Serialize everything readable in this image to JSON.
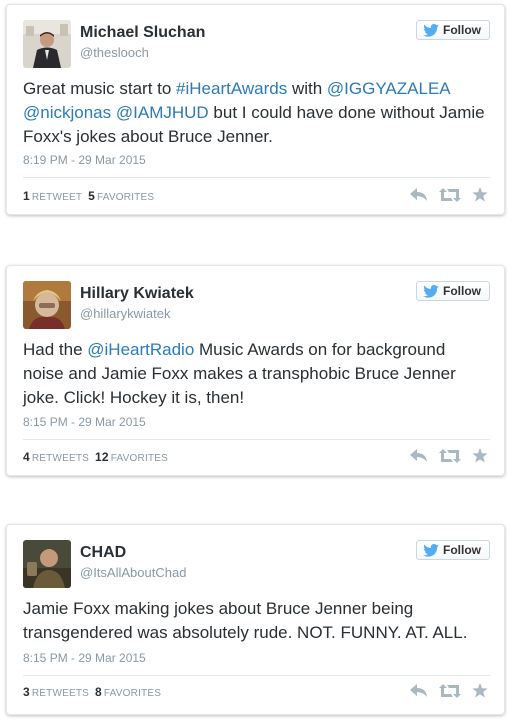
{
  "colors": {
    "link": "#2b7bb9",
    "muted": "#8899a6",
    "icon": "#aab8c2",
    "twitter_blue": "#55acee"
  },
  "tweets": [
    {
      "name": "Michael Sluchan",
      "handle": "@theslooch",
      "follow_label": "Follow",
      "text_parts": [
        {
          "t": "Great music start to ",
          "link": false
        },
        {
          "t": "#iHeartAwards",
          "link": true
        },
        {
          "t": " with ",
          "link": false
        },
        {
          "t": "@IGGYAZALEA",
          "link": true
        },
        {
          "t": " ",
          "link": false
        },
        {
          "t": "@nickjonas",
          "link": true
        },
        {
          "t": " ",
          "link": false
        },
        {
          "t": "@IAMJHUD",
          "link": true
        },
        {
          "t": " but I could have done without Jamie Foxx's jokes about Bruce Jenner.",
          "link": false
        }
      ],
      "timestamp": "8:19 PM - 29 Mar 2015",
      "retweets": "1",
      "retweets_label": "RETWEET",
      "favorites": "5",
      "favorites_label": "FAVORITES"
    },
    {
      "name": "Hillary Kwiatek",
      "handle": "@hillarykwiatek",
      "follow_label": "Follow",
      "text_parts": [
        {
          "t": "Had the ",
          "link": false
        },
        {
          "t": "@iHeartRadio",
          "link": true
        },
        {
          "t": " Music Awards on for background noise and Jamie Foxx makes a transphobic Bruce Jenner joke. Click! Hockey it is, then!",
          "link": false
        }
      ],
      "timestamp": "8:15 PM - 29 Mar 2015",
      "retweets": "4",
      "retweets_label": "RETWEETS",
      "favorites": "12",
      "favorites_label": "FAVORITES"
    },
    {
      "name": "CHAD",
      "handle": "@ItsAllAboutChad",
      "follow_label": "Follow",
      "text_parts": [
        {
          "t": "Jamie Foxx making jokes about Bruce Jenner being transgendered was absolutely rude. NOT. FUNNY. AT. ALL.",
          "link": false
        }
      ],
      "timestamp": "8:15 PM - 29 Mar 2015",
      "retweets": "3",
      "retweets_label": "RETWEETS",
      "favorites": "8",
      "favorites_label": "FAVORITES"
    }
  ]
}
